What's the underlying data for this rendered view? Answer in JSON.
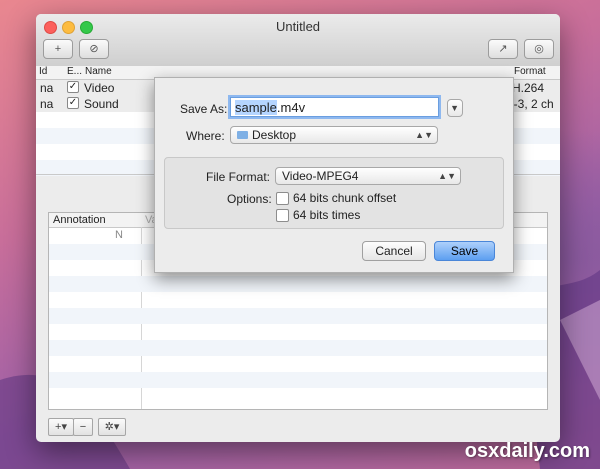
{
  "window": {
    "title": "Untitled"
  },
  "toolbar": {
    "add_icon": "+",
    "revert_icon": "⊘",
    "share_icon": "↗",
    "info_icon": "◎"
  },
  "table": {
    "columns": [
      "Id",
      "E...",
      "Name",
      "Format"
    ],
    "rows": [
      {
        "id": "na",
        "enabled": "✓",
        "name": "Video",
        "format": "H.264"
      },
      {
        "id": "na",
        "enabled": "✓",
        "name": "Sound",
        "format": "AC-3, 2 ch"
      }
    ]
  },
  "annotations": {
    "header": "Annotation",
    "col2": "Value",
    "row1_name": "N"
  },
  "save_dialog": {
    "save_as_label": "Save As:",
    "filename_selected": "sample",
    "filename_ext": ".m4v",
    "where_label": "Where:",
    "where_value": "Desktop",
    "file_format_label": "File Format:",
    "file_format_value": "Video-MPEG4",
    "options_label": "Options:",
    "option1": "64 bits chunk offset",
    "option2": "64 bits times",
    "cancel_label": "Cancel",
    "save_label": "Save"
  },
  "bottom_buttons": {
    "add": "+▾",
    "remove": "−",
    "gear": "✲▾"
  },
  "watermark": "osxdaily.com"
}
